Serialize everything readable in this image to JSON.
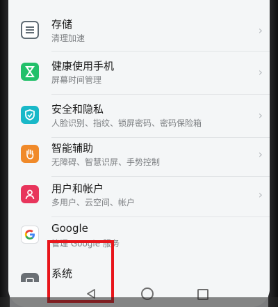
{
  "settings": {
    "items": [
      {
        "title": "存储",
        "subtitle": "清理加速",
        "icon": "storage-icon",
        "color": "#5f6b74"
      },
      {
        "title": "健康使用手机",
        "subtitle": "屏幕时间管理",
        "icon": "hourglass-icon",
        "color": "#22c06a"
      },
      {
        "title": "安全和隐私",
        "subtitle": "人脸识别、指纹、锁屏密码、密码保险箱",
        "icon": "shield-icon",
        "color": "#19b8c8"
      },
      {
        "title": "智能辅助",
        "subtitle": "无障碍、智慧识屏、手势控制",
        "icon": "hand-icon",
        "color": "#f08a2a"
      },
      {
        "title": "用户和帐户",
        "subtitle": "多用户、云空间、帐户",
        "icon": "user-icon",
        "color": "#e8355c"
      },
      {
        "title": "Google",
        "subtitle": "管理 Google 服务",
        "icon": "google-icon",
        "color": "#ffffff"
      },
      {
        "title": "系统",
        "subtitle": "",
        "icon": "system-icon",
        "color": "#6a6f74"
      }
    ]
  },
  "navbar": {
    "back_icon": "back-triangle-icon",
    "home_icon": "home-circle-icon",
    "recent_icon": "recents-square-icon"
  }
}
